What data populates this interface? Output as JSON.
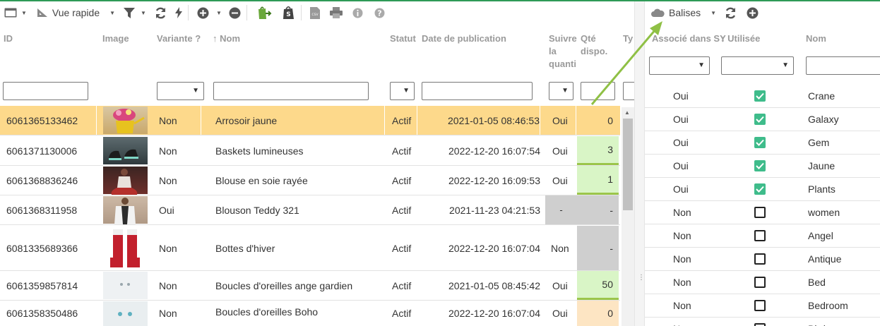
{
  "colors": {
    "accent": "#2e9a57",
    "selected_row": "#fdd98b",
    "qty_green": "#d9f5c6",
    "qty_grey": "#cfcfcf",
    "qty_peach": "#fde5c3",
    "check_on": "#3fbc8b",
    "annotation_arrow": "#8fc045"
  },
  "left_toolbar": {
    "view_label": "Vue rapide",
    "icons": [
      "table-icon",
      "ruler-icon",
      "filter-icon",
      "refresh-icon",
      "bolt-icon",
      "plus-circle-icon",
      "minus-circle-icon",
      "shopify-export-icon",
      "shopify-icon",
      "csv-icon",
      "print-icon",
      "info-icon",
      "help-icon"
    ]
  },
  "left_headers": {
    "id": "ID",
    "image": "Image",
    "variant": "Variante ?",
    "name": "Nom",
    "status": "Statut",
    "pub_date": "Date de publication",
    "follow": [
      "Suivre",
      "la",
      "quanti"
    ],
    "qty": [
      "Qté",
      "dispo."
    ],
    "type": "Ty"
  },
  "rows": [
    {
      "id": "6061365133462",
      "variant": "Non",
      "name": "Arrosoir jaune",
      "status": "Actif",
      "date": "2021-01-05 08:46:53",
      "follow": "Oui",
      "qty": "0"
    },
    {
      "id": "6061371130006",
      "variant": "Non",
      "name": "Baskets lumineuses",
      "status": "Actif",
      "date": "2022-12-20 16:07:54",
      "follow": "Oui",
      "qty": "3"
    },
    {
      "id": "6061368836246",
      "variant": "Non",
      "name": "Blouse en soie rayée",
      "status": "Actif",
      "date": "2022-12-20 16:09:53",
      "follow": "Oui",
      "qty": "1"
    },
    {
      "id": "6061368311958",
      "variant": "Oui",
      "name": "Blouson Teddy 321",
      "status": "Actif",
      "date": "2021-11-23 04:21:53",
      "follow": "-",
      "qty": "-"
    },
    {
      "id": "6081335689366",
      "variant": "Non",
      "name": "Bottes d'hiver",
      "status": "Actif",
      "date": "2022-12-20 16:07:04",
      "follow": "Non",
      "qty": "-"
    },
    {
      "id": "6061359857814",
      "variant": "Non",
      "name": "Boucles d'oreilles ange gardien",
      "status": "Actif",
      "date": "2021-01-05 08:45:42",
      "follow": "Oui",
      "qty": "50"
    },
    {
      "id": "6061358350486",
      "variant": "Non",
      "name": "Boucles d'oreilles Boho",
      "status": "Actif",
      "date": "2022-12-20 16:07:04",
      "follow": "Oui",
      "qty": "0"
    }
  ],
  "right_toolbar": {
    "tags_label": "Balises",
    "icons": [
      "cloud-icon",
      "refresh-icon",
      "plus-circle-icon"
    ]
  },
  "right_headers": {
    "associated": "Associé dans SY",
    "used": "Utilisée",
    "name": "Nom"
  },
  "tags": [
    {
      "assoc": "Oui",
      "used": true,
      "name": "Crane"
    },
    {
      "assoc": "Oui",
      "used": true,
      "name": "Galaxy"
    },
    {
      "assoc": "Oui",
      "used": true,
      "name": "Gem"
    },
    {
      "assoc": "Oui",
      "used": true,
      "name": "Jaune"
    },
    {
      "assoc": "Oui",
      "used": true,
      "name": "Plants"
    },
    {
      "assoc": "Non",
      "used": false,
      "name": "women"
    },
    {
      "assoc": "Non",
      "used": false,
      "name": "Angel"
    },
    {
      "assoc": "Non",
      "used": false,
      "name": "Antique"
    },
    {
      "assoc": "Non",
      "used": false,
      "name": "Bed"
    },
    {
      "assoc": "Non",
      "used": false,
      "name": "Bedroom"
    },
    {
      "assoc": "Non",
      "used": false,
      "name": "Bird"
    }
  ]
}
